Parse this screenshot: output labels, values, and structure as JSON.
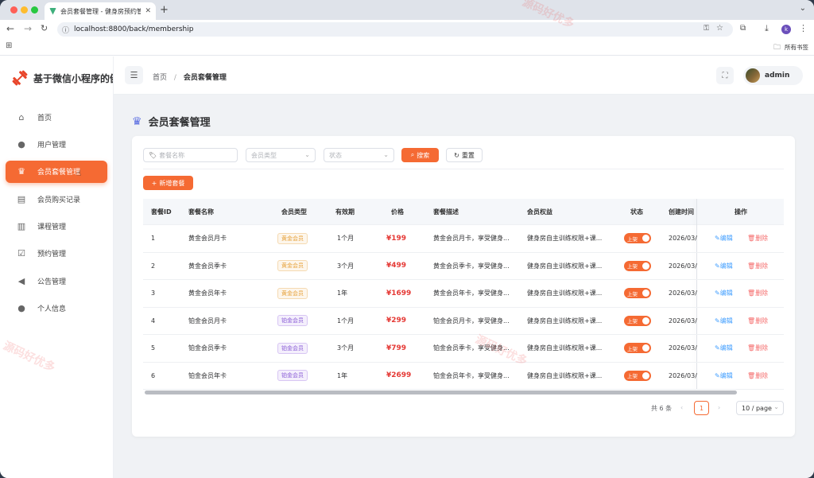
{
  "browser": {
    "tab_title": "会员套餐管理 - 健身房预约管理",
    "url": "localhost:8800/back/membership",
    "bookmarks_label": "所有书签",
    "profile_initial": "k"
  },
  "sidebar": {
    "app_name": "基于微信小程序的健",
    "items": [
      {
        "label": "首页",
        "icon": "home-icon"
      },
      {
        "label": "用户管理",
        "icon": "user-icon"
      },
      {
        "label": "会员套餐管理",
        "icon": "crown-icon",
        "active": true
      },
      {
        "label": "会员购买记录",
        "icon": "document-icon"
      },
      {
        "label": "课程管理",
        "icon": "book-icon"
      },
      {
        "label": "预约管理",
        "icon": "checkbox-icon"
      },
      {
        "label": "公告管理",
        "icon": "megaphone-icon"
      },
      {
        "label": "个人信息",
        "icon": "user-icon"
      }
    ]
  },
  "header": {
    "breadcrumb_home": "首页",
    "breadcrumb_sep": "/",
    "breadcrumb_current": "会员套餐管理",
    "username": "admin"
  },
  "page": {
    "title": "会员套餐管理",
    "filters": {
      "name_placeholder": "套餐名称",
      "type_placeholder": "会员类型",
      "status_placeholder": "状态",
      "search_label": "搜索",
      "reset_label": "重置",
      "add_label": "新增套餐"
    },
    "table": {
      "headers": [
        "套餐ID",
        "套餐名称",
        "会员类型",
        "有效期",
        "价格",
        "套餐描述",
        "会员权益",
        "状态",
        "创建时间",
        "操作"
      ],
      "rows": [
        {
          "id": "1",
          "name": "黄金会员月卡",
          "type": "黄金会员",
          "type_kind": "gold",
          "period": "1个月",
          "price": "¥199",
          "desc": "黄金会员月卡，享受健身...",
          "rights": "健身房自主训练权限+课...",
          "status": "上架",
          "created": "2026/03/"
        },
        {
          "id": "2",
          "name": "黄金会员季卡",
          "type": "黄金会员",
          "type_kind": "gold",
          "period": "3个月",
          "price": "¥499",
          "desc": "黄金会员季卡，享受健身...",
          "rights": "健身房自主训练权限+课...",
          "status": "上架",
          "created": "2026/03/"
        },
        {
          "id": "3",
          "name": "黄金会员年卡",
          "type": "黄金会员",
          "type_kind": "gold",
          "period": "1年",
          "price": "¥1699",
          "desc": "黄金会员年卡，享受健身...",
          "rights": "健身房自主训练权限+课...",
          "status": "上架",
          "created": "2026/03/"
        },
        {
          "id": "4",
          "name": "铂金会员月卡",
          "type": "铂金会员",
          "type_kind": "platinum",
          "period": "1个月",
          "price": "¥299",
          "desc": "铂金会员月卡，享受健身...",
          "rights": "健身房自主训练权限+课...",
          "status": "上架",
          "created": "2026/03/"
        },
        {
          "id": "5",
          "name": "铂金会员季卡",
          "type": "铂金会员",
          "type_kind": "platinum",
          "period": "3个月",
          "price": "¥799",
          "desc": "铂金会员季卡，享受健身...",
          "rights": "健身房自主训练权限+课...",
          "status": "上架",
          "created": "2026/03/"
        },
        {
          "id": "6",
          "name": "铂金会员年卡",
          "type": "铂金会员",
          "type_kind": "platinum",
          "period": "1年",
          "price": "¥2699",
          "desc": "铂金会员年卡，享受健身...",
          "rights": "健身房自主训练权限+课...",
          "status": "上架",
          "created": "2026/03/"
        }
      ],
      "edit_label": "编辑",
      "delete_label": "删除"
    },
    "pagination": {
      "total_text": "共 6 条",
      "current_page": "1",
      "page_size": "10 / page"
    }
  },
  "watermark_text": "源码好优多",
  "colors": {
    "accent": "#f56a33",
    "link": "#409eff",
    "danger": "#f56c6c",
    "price": "#e53935"
  }
}
